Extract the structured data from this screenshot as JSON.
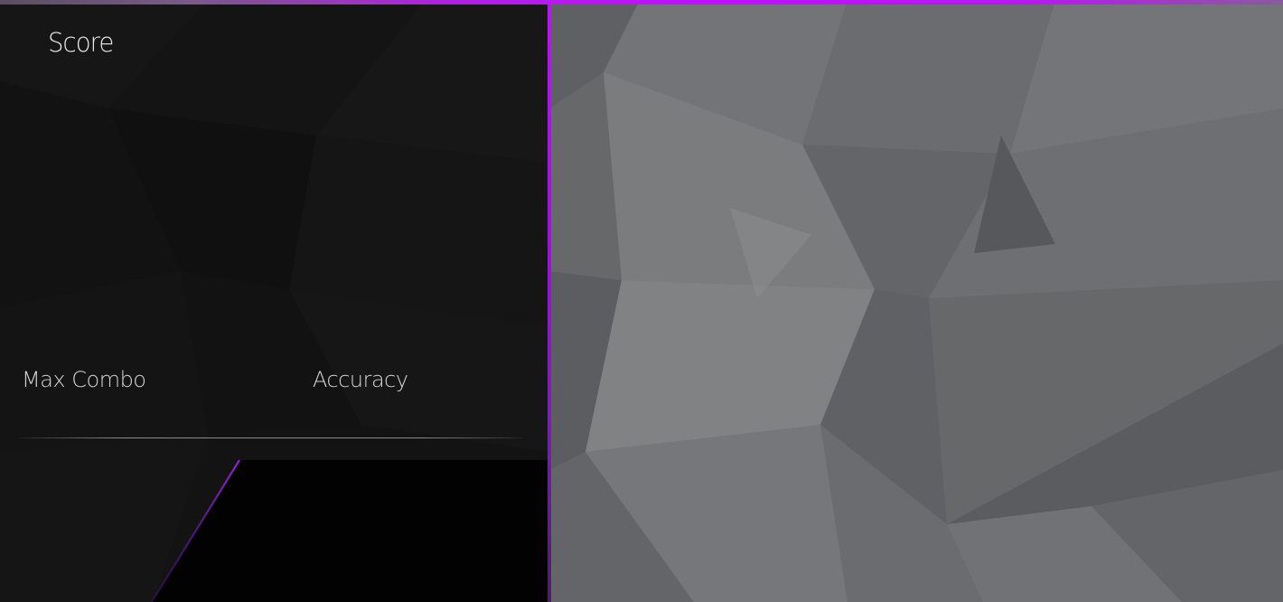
{
  "results": {
    "score_label": "Score",
    "max_combo_label": "Max Combo",
    "accuracy_label": "Accuracy"
  },
  "colors": {
    "accent": "#c010ff",
    "panel_bg": "#131314",
    "backdrop_bg": "#6c6e70"
  }
}
